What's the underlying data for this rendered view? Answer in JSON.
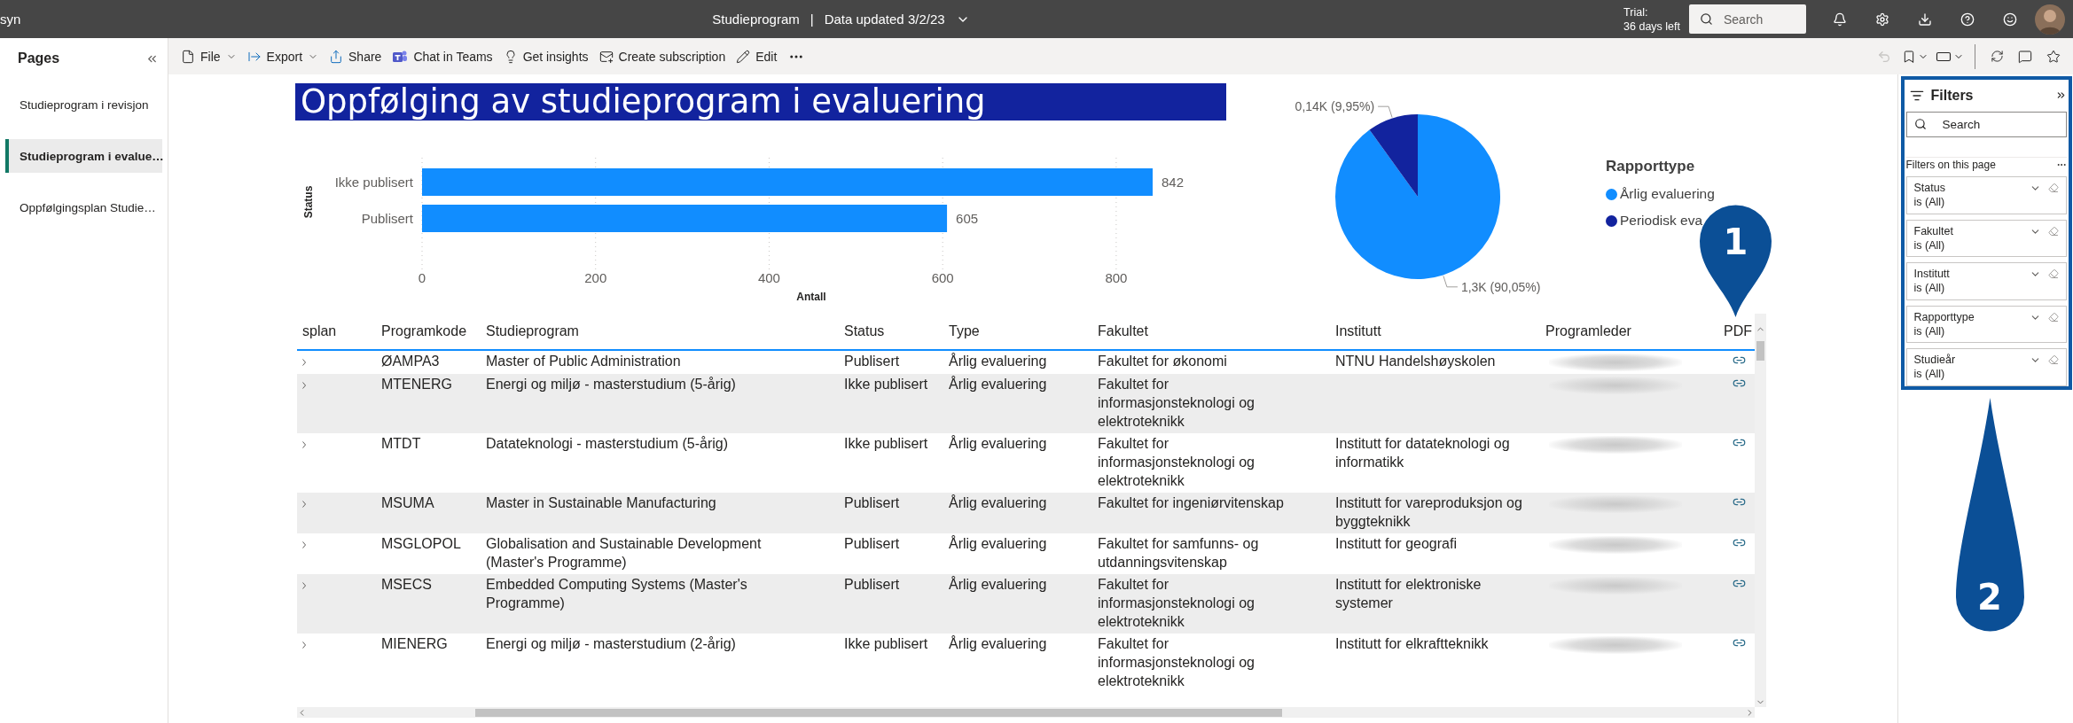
{
  "top_bar": {
    "app_name_fragment": "syn",
    "report_title": "Studieprogram",
    "separator": "|",
    "data_updated": "Data updated 3/2/23",
    "trial_label": "Trial:",
    "trial_days": "36 days left",
    "search": {
      "placeholder": "Search"
    }
  },
  "toolbar": {
    "items": [
      {
        "label": "File",
        "kind": "menu"
      },
      {
        "label": "Export",
        "kind": "menu"
      },
      {
        "label": "Share",
        "kind": "button"
      },
      {
        "label": "Chat in Teams",
        "kind": "button"
      },
      {
        "label": "Get insights",
        "kind": "button"
      },
      {
        "label": "Create subscription",
        "kind": "button"
      },
      {
        "label": "Edit",
        "kind": "button"
      }
    ]
  },
  "pages_pane": {
    "title": "Pages",
    "items": [
      {
        "label": "Studieprogram i revisjon",
        "selected": false
      },
      {
        "label": "Studieprogram i evalue…",
        "selected": true
      },
      {
        "label": "Oppfølgingsplan Studie…",
        "selected": false
      }
    ]
  },
  "report": {
    "title": "Oppfølging av studieprogram i evaluering",
    "bar_chart": {
      "chart_data": {
        "type": "bar",
        "orientation": "horizontal",
        "xlabel": "Antall",
        "ylabel": "Status",
        "categories": [
          "Ikke publisert",
          "Publisert"
        ],
        "series": [
          {
            "color": "#118dff",
            "values": [
              842,
              605
            ]
          }
        ],
        "xlim": [
          0,
          842
        ],
        "xticks": [
          0,
          200,
          400,
          600,
          800
        ],
        "grid": true,
        "value_labels": [
          "842",
          "605"
        ]
      }
    },
    "pie_chart": {
      "legend_title": "Rapporttype",
      "legend_items": [
        {
          "label": "Årlig evaluering",
          "color": "#118dff"
        },
        {
          "label": "Periodisk eva",
          "color": "#12239e"
        }
      ],
      "chart_data": {
        "type": "pie",
        "values": [
          90.05,
          9.95
        ],
        "value_labels": [
          "1,3K (90,05%)",
          "0,14K (9,95%)"
        ]
      }
    }
  },
  "table": {
    "columns": [
      {
        "label": "splan"
      },
      {
        "label": "Programkode"
      },
      {
        "label": "Studieprogram"
      },
      {
        "label": "Status"
      },
      {
        "label": "Type"
      },
      {
        "label": "Fakultet"
      },
      {
        "label": "Institutt"
      },
      {
        "label": "Programleder"
      },
      {
        "label": "PDF"
      }
    ],
    "rows": [
      {
        "programkode": "ØAMPA3",
        "studieprogram": "Master of Public Administration",
        "status": "Publisert",
        "type": "Årlig evaluering",
        "fakultet": "Fakultet for økonomi",
        "institutt": "NTNU Handelshøyskolen"
      },
      {
        "programkode": "MTENERG",
        "studieprogram": "Energi og miljø - masterstudium (5-årig)",
        "status": "Ikke publisert",
        "type": "Årlig evaluering",
        "fakultet": "Fakultet for informasjonsteknologi og elektroteknikk"
      },
      {
        "programkode": "MTDT",
        "studieprogram": "Datateknologi - masterstudium (5-årig)",
        "status": "Ikke publisert",
        "type": "Årlig evaluering",
        "fakultet": "Fakultet for informasjonsteknologi og elektroteknikk",
        "institutt": "Institutt for datateknologi og informatikk"
      },
      {
        "programkode": "MSUMA",
        "studieprogram": "Master in Sustainable Manufacturing",
        "status": "Publisert",
        "type": "Årlig evaluering",
        "fakultet": "Fakultet for ingeniørvitenskap",
        "institutt": "Institutt for vareproduksjon og byggteknikk"
      },
      {
        "programkode": "MSGLOPOL",
        "studieprogram": "Globalisation and Sustainable Development (Master's Programme)",
        "status": "Publisert",
        "type": "Årlig evaluering",
        "fakultet": "Fakultet for samfunns- og utdanningsvitenskap",
        "institutt": "Institutt for geografi"
      },
      {
        "programkode": "MSECS",
        "studieprogram": "Embedded Computing Systems (Master's Programme)",
        "status": "Publisert",
        "type": "Årlig evaluering",
        "fakultet": "Fakultet for informasjonsteknologi og elektroteknikk",
        "institutt": "Institutt for elektroniske systemer"
      },
      {
        "programkode": "MIENERG",
        "studieprogram": "Energi og miljø - masterstudium (2-årig)",
        "status": "Ikke publisert",
        "type": "Årlig evaluering",
        "fakultet": "Fakultet for informasjonsteknologi og elektroteknikk",
        "institutt": "Institutt for elkraftteknikk"
      }
    ]
  },
  "filters_pane": {
    "title": "Filters",
    "search": {
      "placeholder": "Search"
    },
    "section_label": "Filters on this page",
    "filters": [
      {
        "name": "Status",
        "value": "is (All)"
      },
      {
        "name": "Fakultet",
        "value": "is (All)"
      },
      {
        "name": "Institutt",
        "value": "is (All)"
      },
      {
        "name": "Rapporttype",
        "value": "is (All)"
      },
      {
        "name": "Studieår",
        "value": "is (All)"
      }
    ]
  },
  "annotations": [
    {
      "label": "1"
    },
    {
      "label": "2"
    }
  ]
}
